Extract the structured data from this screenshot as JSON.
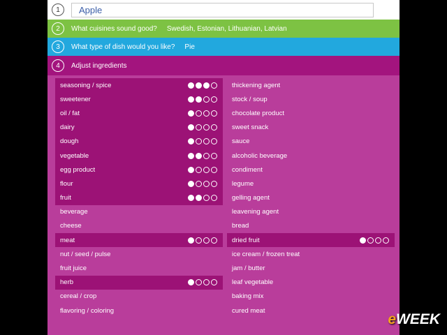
{
  "steps": {
    "step1": {
      "number": "1",
      "value": "Apple"
    },
    "step2": {
      "number": "2",
      "question": "What cuisines sound good?",
      "answer": "Swedish, Estonian, Lithuanian, Latvian"
    },
    "step3": {
      "number": "3",
      "question": "What type of dish would you like?",
      "answer": "Pie"
    },
    "step4": {
      "number": "4",
      "title": "Adjust ingredients"
    }
  },
  "ingredients": {
    "left": [
      {
        "label": "seasoning / spice",
        "level": 3
      },
      {
        "label": "sweetener",
        "level": 2
      },
      {
        "label": "oil / fat",
        "level": 1
      },
      {
        "label": "dairy",
        "level": 1
      },
      {
        "label": "dough",
        "level": 1
      },
      {
        "label": "vegetable",
        "level": 2
      },
      {
        "label": "egg product",
        "level": 1
      },
      {
        "label": "flour",
        "level": 1
      },
      {
        "label": "fruit",
        "level": 2
      },
      {
        "label": "beverage",
        "level": 0
      },
      {
        "label": "cheese",
        "level": 0
      },
      {
        "label": "meat",
        "level": 1
      },
      {
        "label": "nut / seed / pulse",
        "level": 0
      },
      {
        "label": "fruit juice",
        "level": 0
      },
      {
        "label": "herb",
        "level": 1
      },
      {
        "label": "cereal / crop",
        "level": 0
      },
      {
        "label": "flavoring / coloring",
        "level": 0
      }
    ],
    "right": [
      {
        "label": "thickening agent",
        "level": 0
      },
      {
        "label": "stock / soup",
        "level": 0
      },
      {
        "label": "chocolate product",
        "level": 0
      },
      {
        "label": "sweet snack",
        "level": 0
      },
      {
        "label": "sauce",
        "level": 0
      },
      {
        "label": "alcoholic beverage",
        "level": 0
      },
      {
        "label": "condiment",
        "level": 0
      },
      {
        "label": "legume",
        "level": 0
      },
      {
        "label": "gelling agent",
        "level": 0
      },
      {
        "label": "leavening agent",
        "level": 0
      },
      {
        "label": "bread",
        "level": 0
      },
      {
        "label": "dried fruit",
        "level": 1
      },
      {
        "label": "ice cream / frozen treat",
        "level": 0
      },
      {
        "label": "jam / butter",
        "level": 0
      },
      {
        "label": "leaf vegetable",
        "level": 0
      },
      {
        "label": "baking mix",
        "level": 0
      },
      {
        "label": "cured meat",
        "level": 0
      }
    ]
  },
  "watermark": {
    "prefix": "e",
    "rest": "WEEK"
  },
  "colors": {
    "green": "#7dc243",
    "blue": "#22a8de",
    "magenta": "#a3147e",
    "panel": "#b93d9b",
    "selected": "#9c1276"
  }
}
